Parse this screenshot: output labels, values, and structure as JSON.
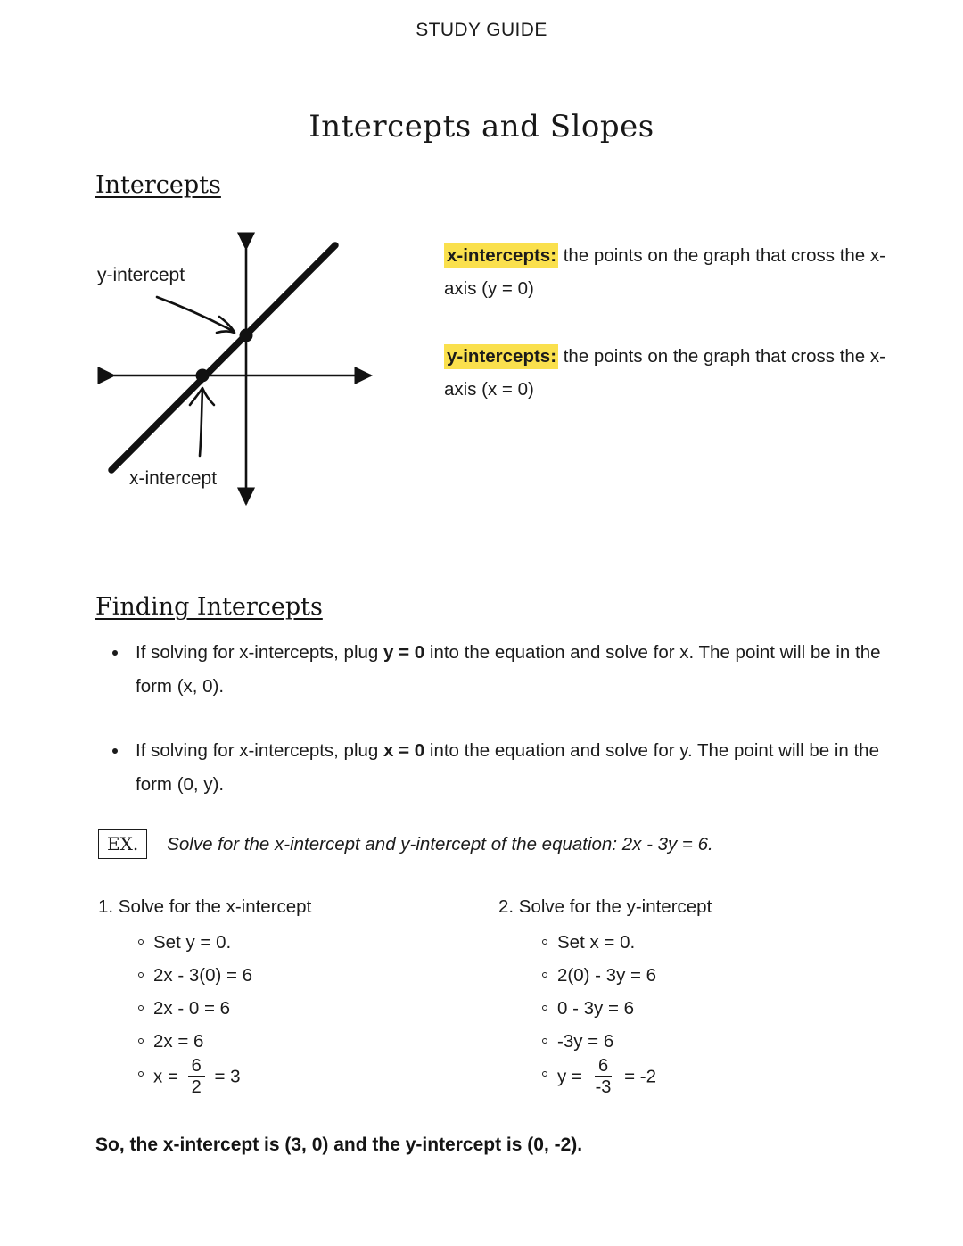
{
  "header": {
    "label": "STUDY GUIDE",
    "title": "Intercepts and Slopes"
  },
  "sections": {
    "intercepts_heading": "Intercepts",
    "finding_heading": "Finding Intercepts"
  },
  "graph": {
    "y_label": "y-intercept",
    "x_label": "x-intercept",
    "description": "Coordinate plane with a diagonal line crossing both axes; dots mark the x-intercept and y-intercept",
    "line_color": "#111111",
    "axis_color": "#111111"
  },
  "definitions": [
    {
      "term": "x-intercepts:",
      "body": " the points on the graph that cross the x-axis (y = 0)",
      "highlight_color": "#fae04d"
    },
    {
      "term": "y-intercepts:",
      "body": " the points on the graph that cross the x-axis  (x = 0)",
      "highlight_color": "#fae04d"
    }
  ],
  "rules": [
    {
      "lead": "If solving for x-intercepts, plug ",
      "emphasis": "y = 0",
      "tail": " into the equation and solve for x. The point will be in the form (x, 0)."
    },
    {
      "lead": "If solving for x-intercepts, plug ",
      "emphasis": "x = 0",
      "tail": " into the equation and solve for y. The point will be in the form (0, y)."
    }
  ],
  "example": {
    "badge": "EX.",
    "prompt": "Solve for the x-intercept and y-intercept of the equation: 2x - 3y = 6."
  },
  "solution_columns": [
    {
      "title": "1. Solve for the x-intercept",
      "steps": [
        "Set y = 0.",
        "2x - 3(0) = 6",
        "2x - 0 = 6",
        "2x = 6"
      ],
      "final": {
        "prefix": "x = ",
        "numerator": "6",
        "denominator": "2",
        "suffix": " = 3"
      }
    },
    {
      "title": "2. Solve for the y-intercept",
      "steps": [
        "Set x = 0.",
        "2(0) - 3y = 6",
        "0 - 3y = 6",
        "-3y = 6"
      ],
      "final": {
        "prefix": "y = ",
        "numerator": "6",
        "denominator": "-3",
        "suffix": " = -2"
      }
    }
  ],
  "conclusion": "So, the x-intercept is (3, 0) and the y-intercept is (0, -2)."
}
